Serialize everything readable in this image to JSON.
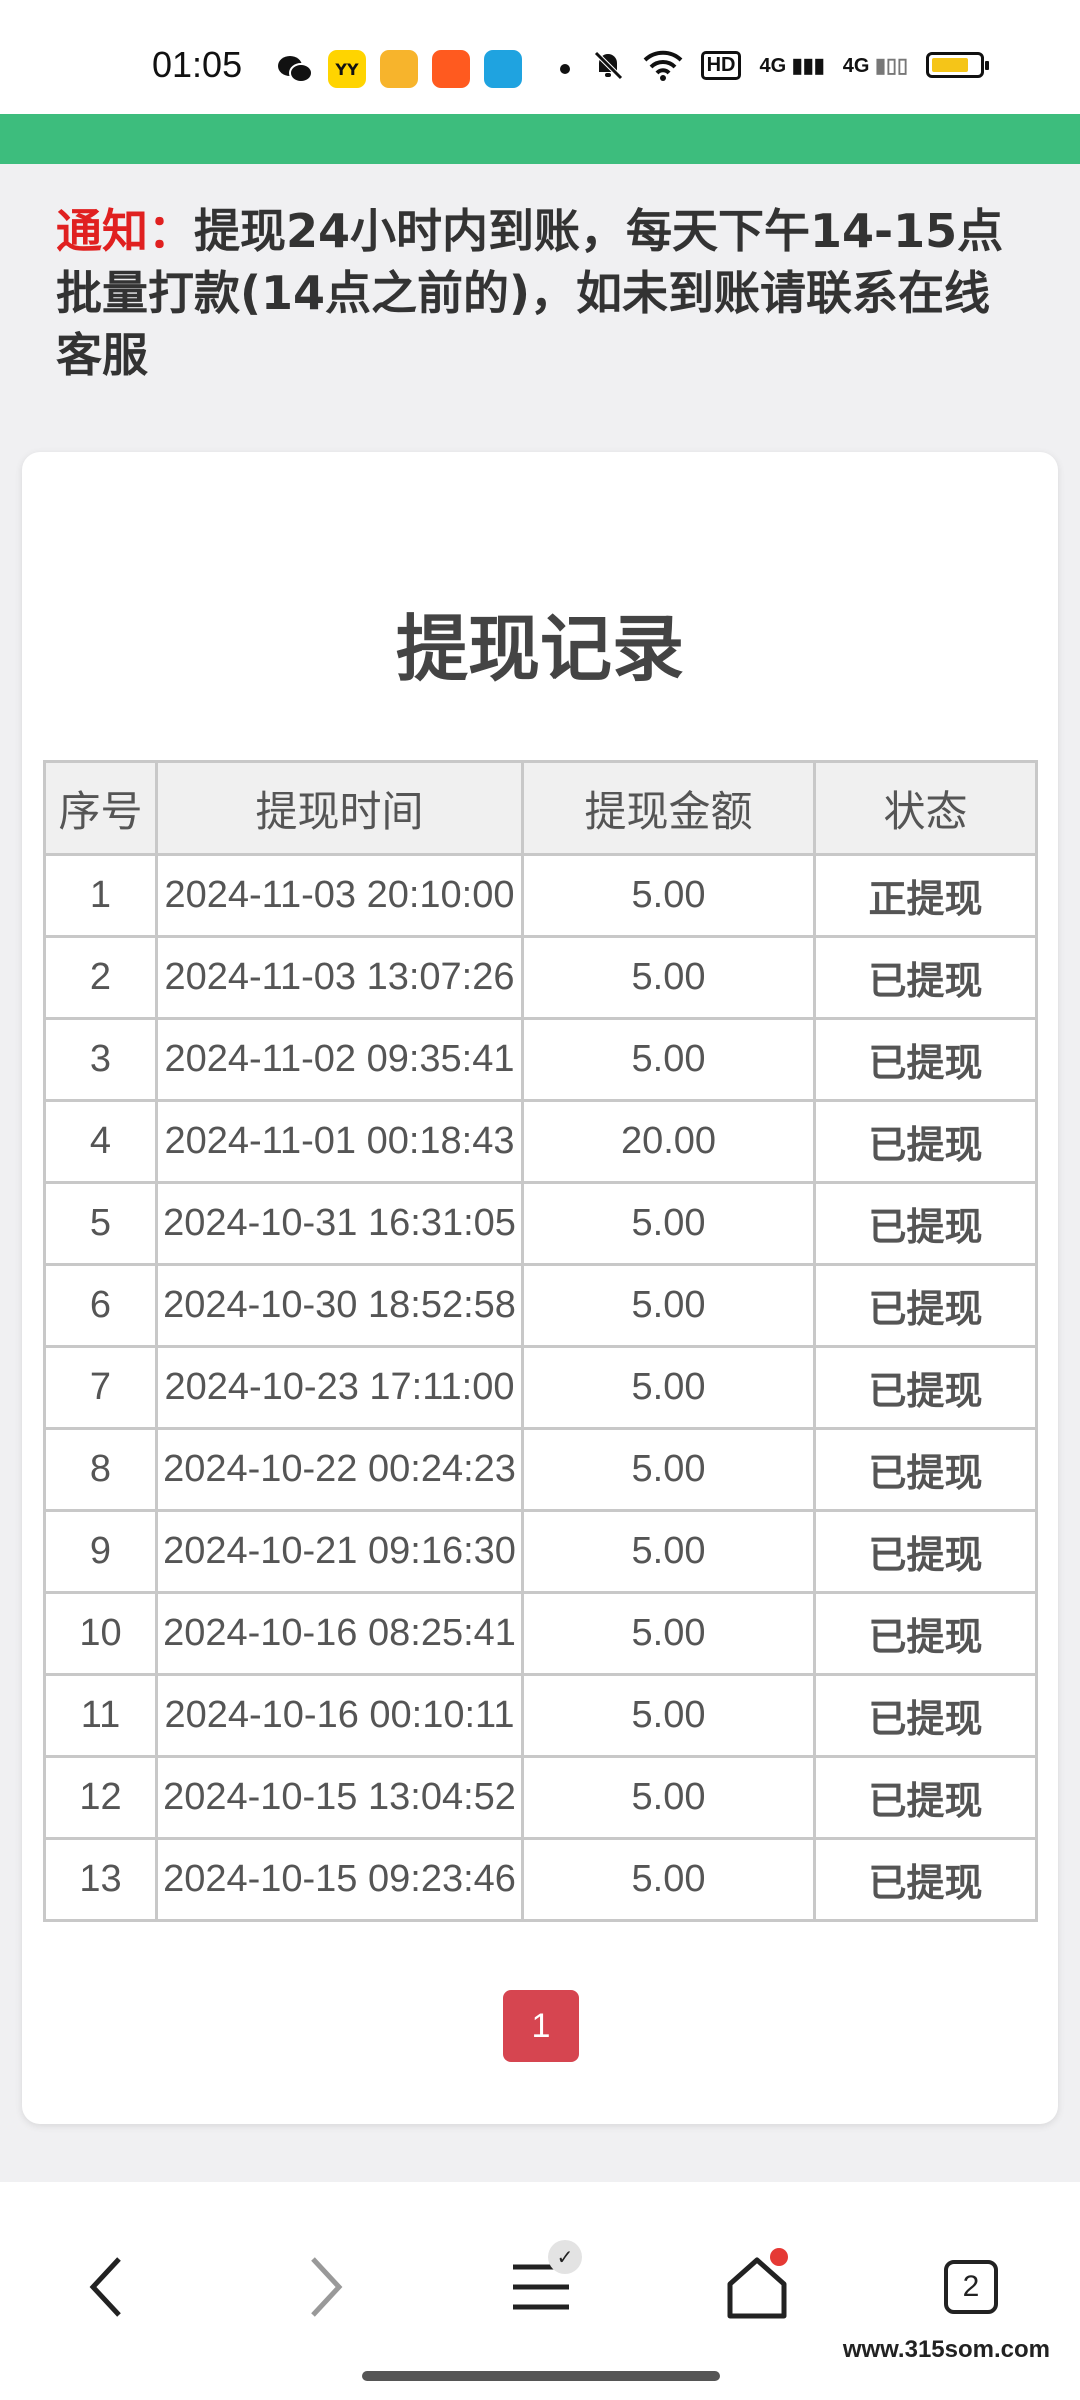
{
  "status_bar": {
    "time": "01:05",
    "network_1": "4G",
    "network_2": "4G",
    "hd": "HD"
  },
  "notice": {
    "label": "通知：",
    "text": "提现24小时内到账，每天下午14-15点批量打款(14点之前的)，如未到账请联系在线客服"
  },
  "records": {
    "title": "提现记录",
    "headers": [
      "序号",
      "提现时间",
      "提现金额",
      "状态"
    ],
    "rows": [
      {
        "no": "1",
        "time": "2024-11-03 20:10:00",
        "amount": "5.00",
        "status": "正提现",
        "state": "pending"
      },
      {
        "no": "2",
        "time": "2024-11-03 13:07:26",
        "amount": "5.00",
        "status": "已提现",
        "state": "done"
      },
      {
        "no": "3",
        "time": "2024-11-02 09:35:41",
        "amount": "5.00",
        "status": "已提现",
        "state": "done"
      },
      {
        "no": "4",
        "time": "2024-11-01 00:18:43",
        "amount": "20.00",
        "status": "已提现",
        "state": "done"
      },
      {
        "no": "5",
        "time": "2024-10-31 16:31:05",
        "amount": "5.00",
        "status": "已提现",
        "state": "done"
      },
      {
        "no": "6",
        "time": "2024-10-30 18:52:58",
        "amount": "5.00",
        "status": "已提现",
        "state": "done"
      },
      {
        "no": "7",
        "time": "2024-10-23 17:11:00",
        "amount": "5.00",
        "status": "已提现",
        "state": "done"
      },
      {
        "no": "8",
        "time": "2024-10-22 00:24:23",
        "amount": "5.00",
        "status": "已提现",
        "state": "done"
      },
      {
        "no": "9",
        "time": "2024-10-21 09:16:30",
        "amount": "5.00",
        "status": "已提现",
        "state": "done"
      },
      {
        "no": "10",
        "time": "2024-10-16 08:25:41",
        "amount": "5.00",
        "status": "已提现",
        "state": "done"
      },
      {
        "no": "11",
        "time": "2024-10-16 00:10:11",
        "amount": "5.00",
        "status": "已提现",
        "state": "done"
      },
      {
        "no": "12",
        "time": "2024-10-15 13:04:52",
        "amount": "5.00",
        "status": "已提现",
        "state": "done"
      },
      {
        "no": "13",
        "time": "2024-10-15 09:23:46",
        "amount": "5.00",
        "status": "已提现",
        "state": "done"
      }
    ]
  },
  "pagination": {
    "current": "1"
  },
  "bottom_nav": {
    "tab_count": "2",
    "icons": [
      "back-arrow-icon",
      "forward-arrow-icon",
      "menu-icon",
      "home-icon",
      "tabs-icon"
    ]
  },
  "watermark": "www.315som.com",
  "colors": {
    "header_green": "#3dbd7d",
    "notice_red": "#e02020",
    "status_pending": "#cc1010",
    "status_done": "#178a17",
    "page_button": "#d64550"
  }
}
